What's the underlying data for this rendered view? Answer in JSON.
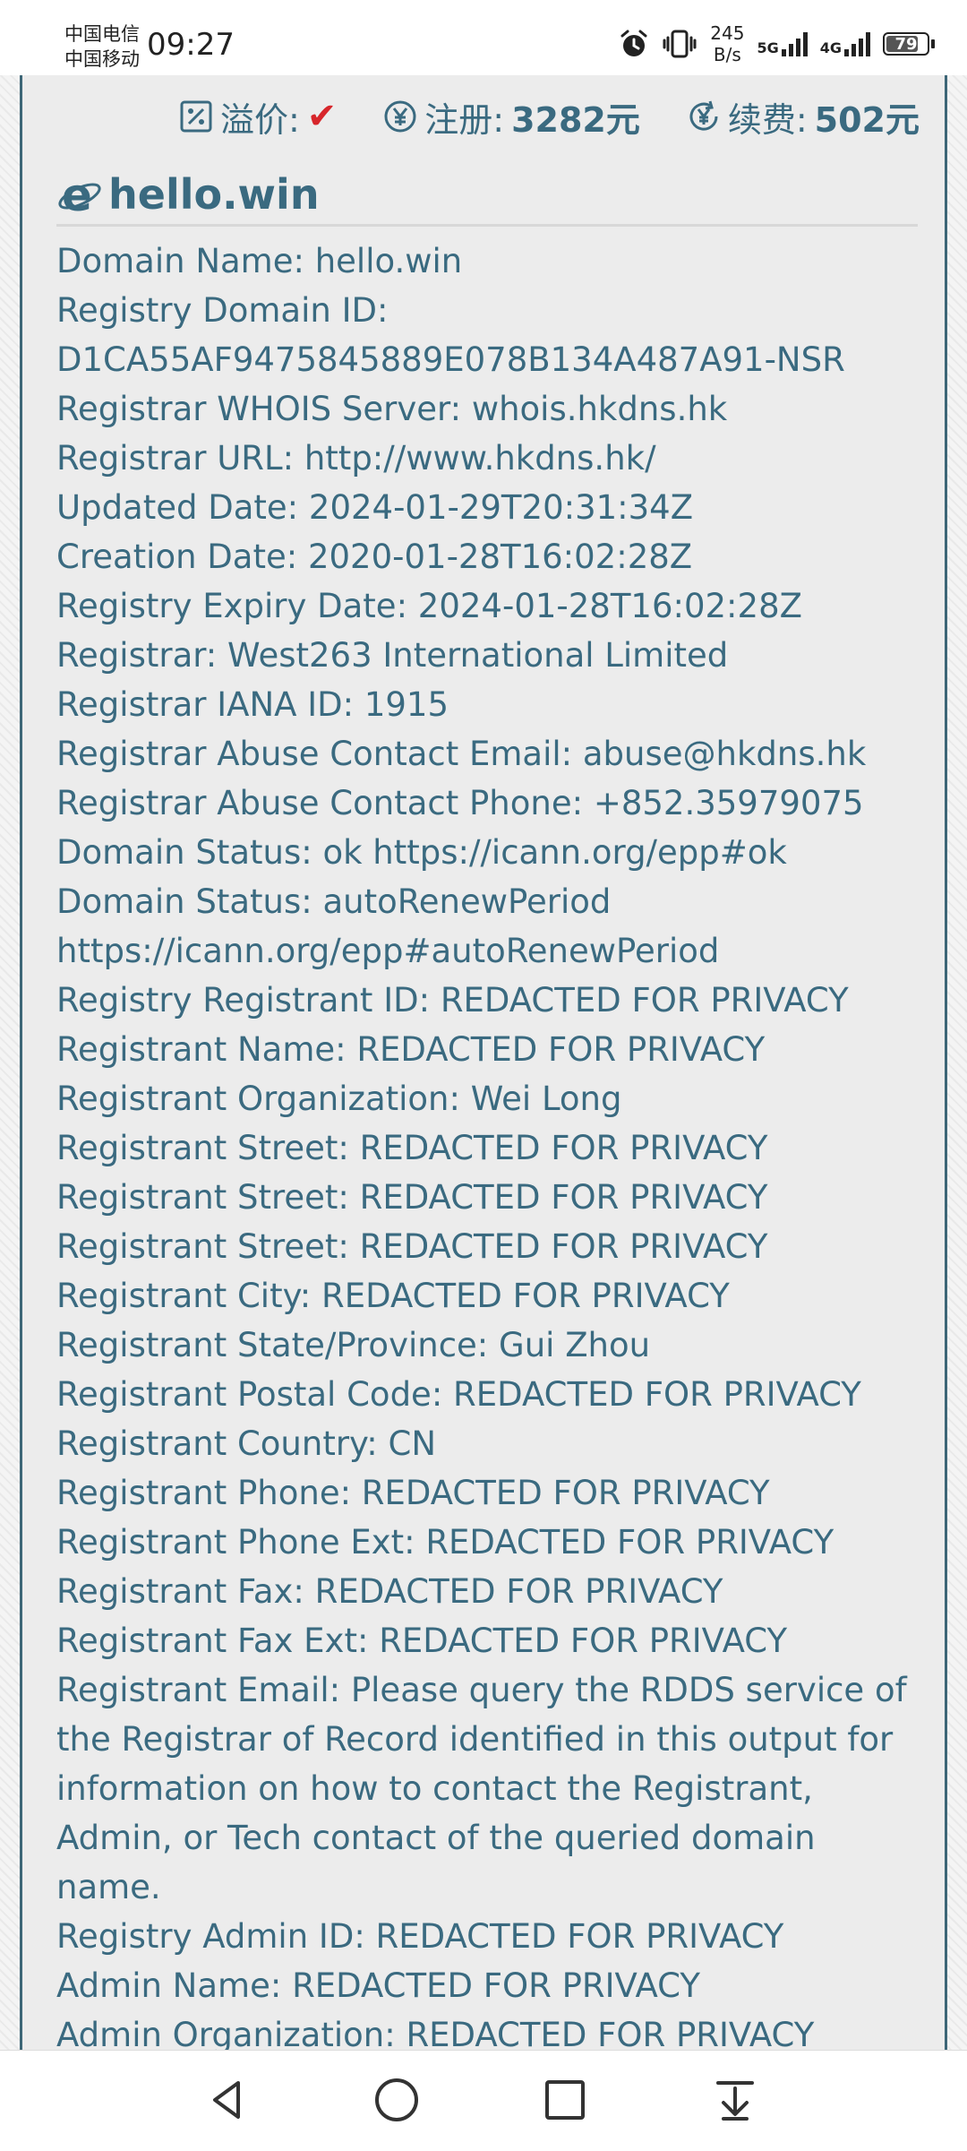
{
  "status_bar": {
    "carrier_1": "中国电信",
    "carrier_2": "中国移动",
    "time": "09:27",
    "net_speed_value": "245",
    "net_speed_unit": "B/s",
    "sig_5g": "5G",
    "sig_4g": "4G",
    "battery": "79",
    "battery_level": 0.79,
    "icons": [
      "alarm-icon",
      "vibrate-icon",
      "signal-5g-icon",
      "signal-4g-icon",
      "battery-icon"
    ]
  },
  "prices": {
    "premium_label": "溢价:",
    "register_label": "注册:",
    "register_value": "3282元",
    "renew_label": "续费:",
    "renew_value": "502元"
  },
  "domain": {
    "title": "hello.win"
  },
  "whois_lines": [
    "Domain Name: hello.win",
    "Registry Domain ID:",
    "D1CA55AF9475845889E078B134A487A91-NSR",
    "Registrar WHOIS Server: whois.hkdns.hk",
    "Registrar URL: http://www.hkdns.hk/",
    "Updated Date: 2024-01-29T20:31:34Z",
    "Creation Date: 2020-01-28T16:02:28Z",
    "Registry Expiry Date: 2024-01-28T16:02:28Z",
    "Registrar: West263 International Limited",
    "Registrar IANA ID: 1915",
    "Registrar Abuse Contact Email: abuse@hkdns.hk",
    "Registrar Abuse Contact Phone: +852.35979075",
    "Domain Status: ok https://icann.org/epp#ok",
    "Domain Status: autoRenewPeriod",
    "https://icann.org/epp#autoRenewPeriod",
    "Registry Registrant ID: REDACTED FOR PRIVACY",
    "Registrant Name: REDACTED FOR PRIVACY",
    "Registrant Organization: Wei Long",
    "Registrant Street: REDACTED FOR PRIVACY",
    "Registrant Street: REDACTED FOR PRIVACY",
    "Registrant Street: REDACTED FOR PRIVACY",
    "Registrant City: REDACTED FOR PRIVACY",
    "Registrant State/Province: Gui Zhou",
    "Registrant Postal Code: REDACTED FOR PRIVACY",
    "Registrant Country: CN",
    "Registrant Phone: REDACTED FOR PRIVACY",
    "Registrant Phone Ext: REDACTED FOR PRIVACY",
    "Registrant Fax: REDACTED FOR PRIVACY",
    "Registrant Fax Ext: REDACTED FOR PRIVACY",
    "Registrant Email: Please query the RDDS service of",
    "the Registrar of Record identified in this output for",
    "information on how to contact the Registrant,",
    "Admin, or Tech contact of the queried domain",
    "name.",
    "Registry Admin ID: REDACTED FOR PRIVACY",
    "Admin Name: REDACTED FOR PRIVACY",
    "Admin Organization: REDACTED FOR PRIVACY"
  ],
  "nav": {
    "icons": [
      "back-icon",
      "home-icon",
      "recents-icon",
      "notification-pull-icon"
    ]
  },
  "colors": {
    "text": "#3a6a80",
    "border": "#3d6677",
    "panel": "#ececec",
    "check": "#d7262b"
  }
}
